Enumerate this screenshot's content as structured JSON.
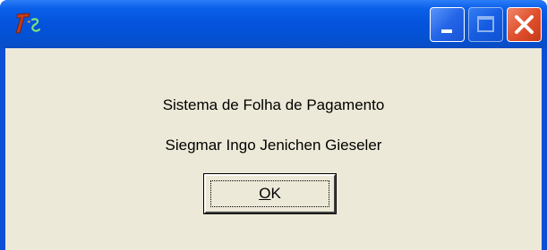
{
  "window": {
    "title": "",
    "app_icon": "app-logo-icon",
    "controls": {
      "minimize_icon": "minimize-icon",
      "maximize_icon": "maximize-icon",
      "close_icon": "close-icon"
    },
    "colors": {
      "titlebar": "#0553dc",
      "client_background": "#ece9d8",
      "close_button": "#e0512e"
    }
  },
  "dialog": {
    "line1": "Sistema de Folha de Pagamento",
    "line2": "Siegmar Ingo Jenichen Gieseler",
    "ok_button": {
      "mnemonic": "O",
      "rest": "K"
    }
  }
}
